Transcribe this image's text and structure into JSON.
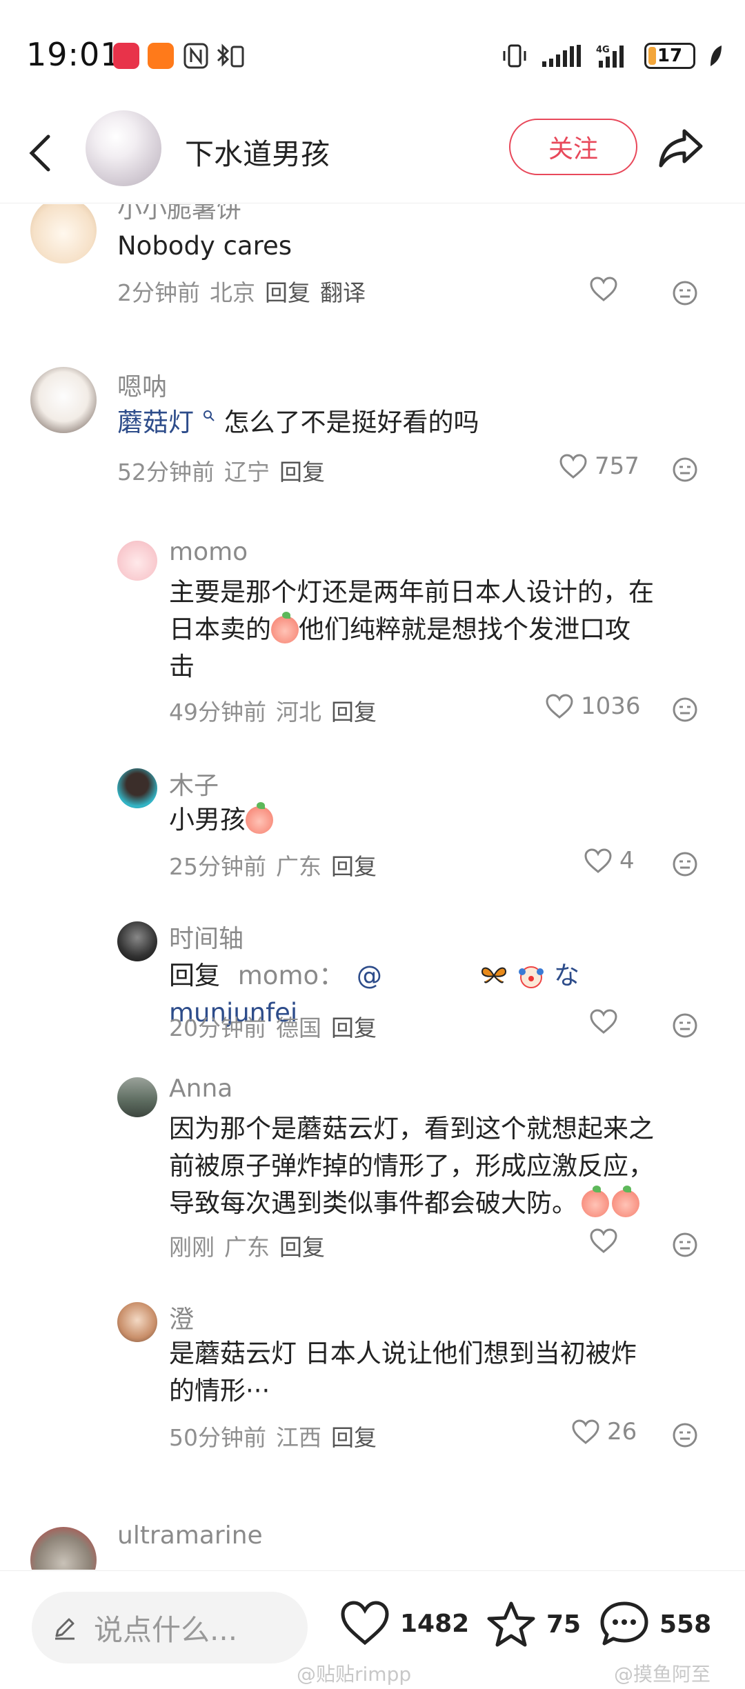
{
  "status_bar": {
    "time": "19:01",
    "battery": "17",
    "battery_fraction": 0.17,
    "app_icons": [
      "huawei-store-icon",
      "taobao-1688-icon",
      "nfc-icon",
      "bluetooth-icon"
    ],
    "right_icons": [
      "vibrate-icon",
      "signal-icon",
      "4g-signal-icon",
      "battery-icon",
      "leaf-icon"
    ]
  },
  "header": {
    "title": "下水道男孩",
    "follow_label": "关注"
  },
  "comments": [
    {
      "username": "小小脆薯饼",
      "text": "Nobody cares",
      "time": "2分钟前",
      "location": "北京",
      "reply_label": "回复",
      "translate_label": "翻译",
      "likes": ""
    },
    {
      "username": "嗯呐",
      "mention": "蘑菇灯",
      "text": "怎么了不是挺好看的吗",
      "time": "52分钟前",
      "location": "辽宁",
      "reply_label": "回复",
      "likes": "757"
    },
    {
      "username": "momo",
      "text_line1": "主要是那个灯还是两年前日本人设计的，在",
      "text_line2a": "日本卖的",
      "text_line2b": "他们纯粹就是想找个发泄口攻",
      "text_line3": "击",
      "time": "49分钟前",
      "location": "河北",
      "reply_label": "回复",
      "likes": "1036"
    },
    {
      "username": "木子",
      "text": "小男孩",
      "time": "25分钟前",
      "location": "广东",
      "reply_label": "回复",
      "likes": "4"
    },
    {
      "username": "时间轴",
      "reply_prefix": "回复",
      "reply_to": "momo：",
      "at": "@",
      "mention_name": "なmunjunfei",
      "time": "20分钟前",
      "location": "德国",
      "reply_label": "回复",
      "likes": ""
    },
    {
      "username": "Anna",
      "text_line1": "因为那个是蘑菇云灯，看到这个就想起来之",
      "text_line2": "前被原子弹炸掉的情形了，形成应激反应，",
      "text_line3": "导致每次遇到类似事件都会破大防。",
      "time": "刚刚",
      "location": "广东",
      "reply_label": "回复",
      "likes": ""
    },
    {
      "username": "澄",
      "text_line1": "是蘑菇云灯 日本人说让他们想到当初被炸",
      "text_line2": "的情形···",
      "time": "50分钟前",
      "location": "江西",
      "reply_label": "回复",
      "likes": "26"
    },
    {
      "username": "ultramarine"
    }
  ],
  "bottom_bar": {
    "input_placeholder": "说点什么...",
    "likes": "1482",
    "favorites": "75",
    "comments": "558",
    "watermark_left": "@贴贴rimpp",
    "watermark_right": "@摸鱼阿至"
  },
  "colors": {
    "accent": "#e8485a",
    "mention": "#2d4c8a",
    "meta": "#8f8f8f"
  }
}
